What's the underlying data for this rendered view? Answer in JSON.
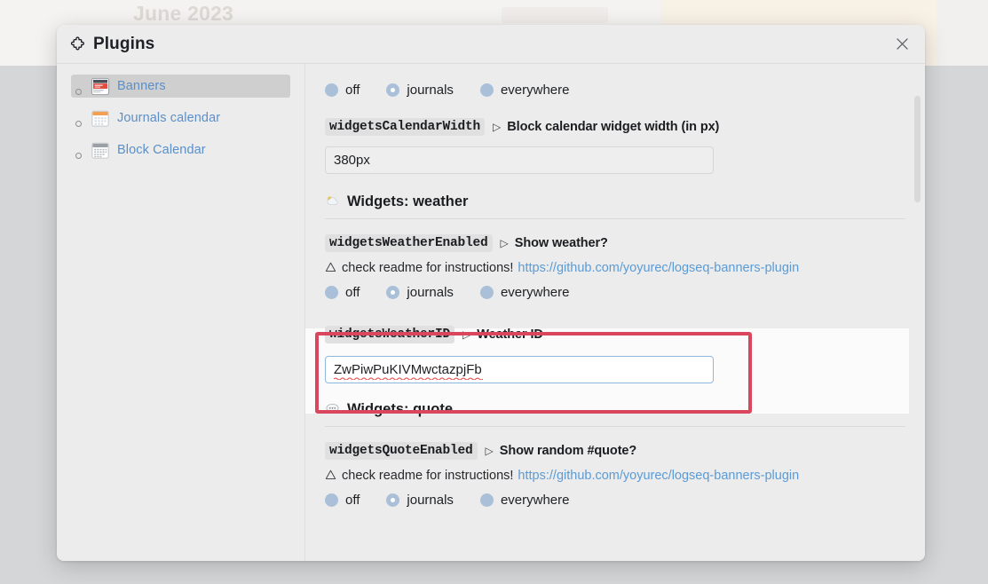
{
  "backdrop": {
    "month_label": "June 2023"
  },
  "modal": {
    "title": "Plugins",
    "icon": "puzzle-piece-icon",
    "close_icon": "close-icon"
  },
  "sidebar": {
    "items": [
      {
        "label": "Banners",
        "icon": "banner-image-icon",
        "selected": true
      },
      {
        "label": "Journals calendar",
        "icon": "calendar-icon",
        "selected": false
      },
      {
        "label": "Block Calendar",
        "icon": "block-calendar-icon",
        "selected": false
      }
    ]
  },
  "settings": {
    "radio_options": [
      "off",
      "journals",
      "everywhere"
    ],
    "radio_selected": "journals",
    "calendar_width": {
      "key": "widgetsCalendarWidth",
      "arrow": "▷",
      "description": "Block calendar widget width (in px)",
      "value": "380px",
      "placeholder": ""
    },
    "weather_section": {
      "emoji": "sun-behind-cloud-icon",
      "title": "Widgets: weather"
    },
    "weather_enabled": {
      "key": "widgetsWeatherEnabled",
      "arrow": "▷",
      "description": "Show weather?",
      "warning_icon": "warning-triangle-icon",
      "warning_text": "check readme for instructions!",
      "link": "https://github.com/yoyurec/logseq-banners-plugin"
    },
    "weather_id": {
      "key": "widgetsWeatherID",
      "arrow": "▷",
      "description": "Weather ID",
      "value": "ZwPiwPuKIVMwctazpjFb",
      "placeholder": ""
    },
    "quote_section": {
      "emoji": "speech-balloon-icon",
      "title": "Widgets: quote"
    },
    "quote_enabled": {
      "key": "widgetsQuoteEnabled",
      "arrow": "▷",
      "description": "Show random #quote?",
      "warning_icon": "warning-triangle-icon",
      "warning_text": "check readme for instructions!",
      "link": "https://github.com/yoyurec/logseq-banners-plugin"
    }
  },
  "annotation": {
    "color": "#d9465d",
    "target": "widgetsWeatherID"
  }
}
